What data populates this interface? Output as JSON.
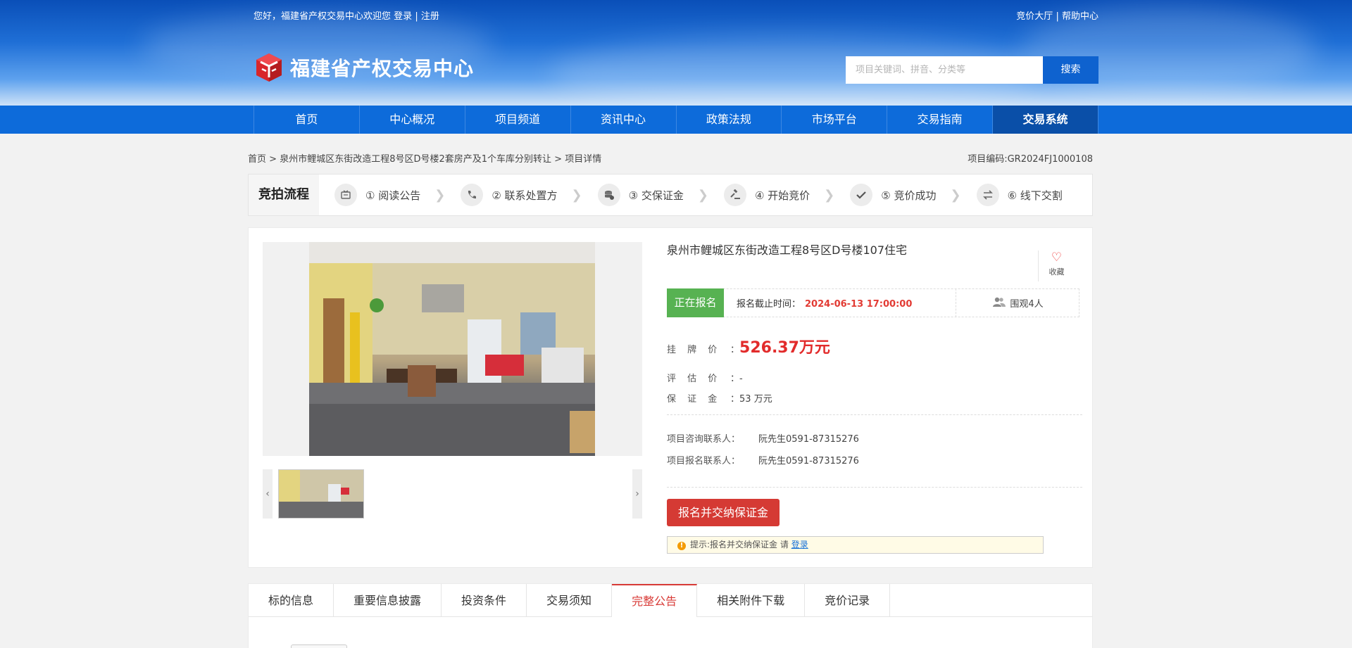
{
  "topbar": {
    "greeting": "您好，福建省产权交易中心欢迎您",
    "login": "登录",
    "sep": "|",
    "register": "注册",
    "auction_hall": "竞价大厅",
    "help_center": "帮助中心"
  },
  "logo": {
    "name": "福建省产权交易中心"
  },
  "search": {
    "placeholder": "项目关键词、拼音、分类等",
    "button": "搜索"
  },
  "nav": {
    "items": [
      "首页",
      "中心概况",
      "项目频道",
      "资讯中心",
      "政策法规",
      "市场平台",
      "交易指南",
      "交易系统"
    ],
    "active_index": 7
  },
  "breadcrumb": {
    "home": "首页",
    "sep": ">",
    "category": "泉州市鲤城区东街改造工程8号区D号楼2套房产及1个车库分别转让",
    "current": "项目详情",
    "project_code": "项目编码:GR2024FJ1000108"
  },
  "process": {
    "title": "竞拍流程",
    "steps": [
      {
        "label": "① 阅读公告",
        "icon": "notice-icon"
      },
      {
        "label": "② 联系处置方",
        "icon": "phone-icon"
      },
      {
        "label": "③ 交保证金",
        "icon": "coins-icon"
      },
      {
        "label": "④ 开始竞价",
        "icon": "gavel-icon"
      },
      {
        "label": "⑤ 竞价成功",
        "icon": "check-icon"
      },
      {
        "label": "⑥ 线下交割",
        "icon": "exchange-icon"
      }
    ]
  },
  "project": {
    "title": "泉州市鲤城区东街改造工程8号区D号楼107住宅",
    "favorite_label": "收藏",
    "status": "正在报名",
    "deadline_label": "报名截止时间：",
    "deadline": "2024-06-13 17:00:00",
    "watchers": "围观4人",
    "listing_price_label": "挂 牌 价",
    "listing_price": "526.37万元",
    "appraisal_label": "评 估 价",
    "appraisal": "-",
    "deposit_label": "保 证 金",
    "deposit": "53 万元",
    "colon": "：",
    "consult_contact_label": "项目咨询联系人：",
    "consult_contact": "阮先生0591-87315276",
    "signup_contact_label": "项目报名联系人：",
    "signup_contact": "阮先生0591-87315276",
    "apply_button": "报名并交纳保证金",
    "tip_text": "提示:报名并交纳保证金 请",
    "tip_link": "登录"
  },
  "tabs": {
    "items": [
      "标的信息",
      "重要信息披露",
      "投资条件",
      "交易须知",
      "完整公告",
      "相关附件下载",
      "竞价记录"
    ],
    "active_index": 4
  },
  "colors": {
    "brand_blue": "#0d6bda",
    "accent_red": "#d53a34",
    "status_green": "#57b252"
  }
}
